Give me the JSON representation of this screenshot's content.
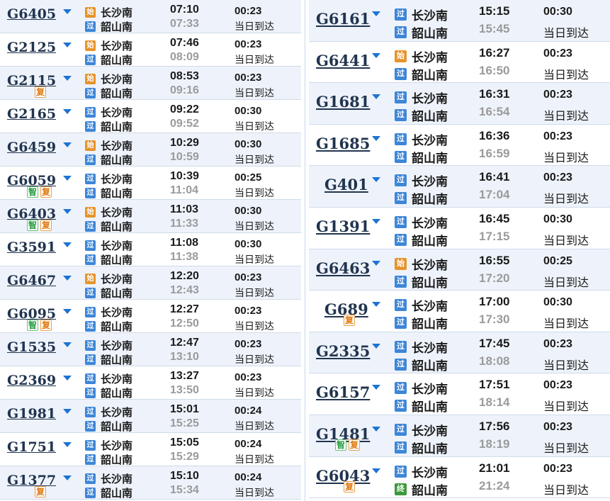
{
  "left_trains": [
    {
      "no": "G6405",
      "tags": [],
      "from_icon": "始",
      "from": "长沙南",
      "to_icon": "过",
      "to": "韶山南",
      "dep": "07:10",
      "arr": "07:33",
      "dur": "00:23",
      "arrive": "当日到达"
    },
    {
      "no": "G2125",
      "tags": [],
      "from_icon": "始",
      "from": "长沙南",
      "to_icon": "过",
      "to": "韶山南",
      "dep": "07:46",
      "arr": "08:09",
      "dur": "00:23",
      "arrive": "当日到达"
    },
    {
      "no": "G2115",
      "tags": [
        "复"
      ],
      "from_icon": "始",
      "from": "长沙南",
      "to_icon": "过",
      "to": "韶山南",
      "dep": "08:53",
      "arr": "09:16",
      "dur": "00:23",
      "arrive": "当日到达"
    },
    {
      "no": "G2165",
      "tags": [],
      "from_icon": "过",
      "from": "长沙南",
      "to_icon": "过",
      "to": "韶山南",
      "dep": "09:22",
      "arr": "09:52",
      "dur": "00:30",
      "arrive": "当日到达"
    },
    {
      "no": "G6459",
      "tags": [],
      "from_icon": "始",
      "from": "长沙南",
      "to_icon": "过",
      "to": "韶山南",
      "dep": "10:29",
      "arr": "10:59",
      "dur": "00:30",
      "arrive": "当日到达"
    },
    {
      "no": "G6059",
      "tags": [
        "智",
        "复"
      ],
      "from_icon": "过",
      "from": "长沙南",
      "to_icon": "过",
      "to": "韶山南",
      "dep": "10:39",
      "arr": "11:04",
      "dur": "00:25",
      "arrive": "当日到达"
    },
    {
      "no": "G6403",
      "tags": [
        "智",
        "复"
      ],
      "from_icon": "始",
      "from": "长沙南",
      "to_icon": "过",
      "to": "韶山南",
      "dep": "11:03",
      "arr": "11:33",
      "dur": "00:30",
      "arrive": "当日到达"
    },
    {
      "no": "G3591",
      "tags": [],
      "from_icon": "过",
      "from": "长沙南",
      "to_icon": "过",
      "to": "韶山南",
      "dep": "11:08",
      "arr": "11:38",
      "dur": "00:30",
      "arrive": "当日到达"
    },
    {
      "no": "G6467",
      "tags": [],
      "from_icon": "始",
      "from": "长沙南",
      "to_icon": "过",
      "to": "韶山南",
      "dep": "12:20",
      "arr": "12:43",
      "dur": "00:23",
      "arrive": "当日到达"
    },
    {
      "no": "G6095",
      "tags": [
        "智",
        "复"
      ],
      "from_icon": "过",
      "from": "长沙南",
      "to_icon": "过",
      "to": "韶山南",
      "dep": "12:27",
      "arr": "12:50",
      "dur": "00:23",
      "arrive": "当日到达"
    },
    {
      "no": "G1535",
      "tags": [],
      "from_icon": "过",
      "from": "长沙南",
      "to_icon": "过",
      "to": "韶山南",
      "dep": "12:47",
      "arr": "13:10",
      "dur": "00:23",
      "arrive": "当日到达"
    },
    {
      "no": "G2369",
      "tags": [],
      "from_icon": "过",
      "from": "长沙南",
      "to_icon": "过",
      "to": "韶山南",
      "dep": "13:27",
      "arr": "13:50",
      "dur": "00:23",
      "arrive": "当日到达"
    },
    {
      "no": "G1981",
      "tags": [],
      "from_icon": "过",
      "from": "长沙南",
      "to_icon": "过",
      "to": "韶山南",
      "dep": "15:01",
      "arr": "15:25",
      "dur": "00:24",
      "arrive": "当日到达"
    },
    {
      "no": "G1751",
      "tags": [],
      "from_icon": "过",
      "from": "长沙南",
      "to_icon": "过",
      "to": "韶山南",
      "dep": "15:05",
      "arr": "15:29",
      "dur": "00:24",
      "arrive": "当日到达"
    },
    {
      "no": "G1377",
      "tags": [
        "复"
      ],
      "from_icon": "过",
      "from": "长沙南",
      "to_icon": "过",
      "to": "韶山南",
      "dep": "15:10",
      "arr": "15:34",
      "dur": "00:24",
      "arrive": "当日到达"
    }
  ],
  "right_trains": [
    {
      "no": "G6161",
      "tags": [],
      "from_icon": "过",
      "from": "长沙南",
      "to_icon": "过",
      "to": "韶山南",
      "dep": "15:15",
      "arr": "15:45",
      "dur": "00:30",
      "arrive": "当日到达"
    },
    {
      "no": "G6441",
      "tags": [],
      "from_icon": "始",
      "from": "长沙南",
      "to_icon": "过",
      "to": "韶山南",
      "dep": "16:27",
      "arr": "16:50",
      "dur": "00:23",
      "arrive": "当日到达"
    },
    {
      "no": "G1681",
      "tags": [],
      "from_icon": "过",
      "from": "长沙南",
      "to_icon": "过",
      "to": "韶山南",
      "dep": "16:31",
      "arr": "16:54",
      "dur": "00:23",
      "arrive": "当日到达"
    },
    {
      "no": "G1685",
      "tags": [],
      "from_icon": "过",
      "from": "长沙南",
      "to_icon": "过",
      "to": "韶山南",
      "dep": "16:36",
      "arr": "16:59",
      "dur": "00:23",
      "arrive": "当日到达"
    },
    {
      "no": "G401",
      "tags": [],
      "from_icon": "过",
      "from": "长沙南",
      "to_icon": "过",
      "to": "韶山南",
      "dep": "16:41",
      "arr": "17:04",
      "dur": "00:23",
      "arrive": "当日到达"
    },
    {
      "no": "G1391",
      "tags": [],
      "from_icon": "过",
      "from": "长沙南",
      "to_icon": "过",
      "to": "韶山南",
      "dep": "16:45",
      "arr": "17:15",
      "dur": "00:30",
      "arrive": "当日到达"
    },
    {
      "no": "G6463",
      "tags": [],
      "from_icon": "始",
      "from": "长沙南",
      "to_icon": "过",
      "to": "韶山南",
      "dep": "16:55",
      "arr": "17:20",
      "dur": "00:25",
      "arrive": "当日到达"
    },
    {
      "no": "G689",
      "tags": [
        "复"
      ],
      "from_icon": "过",
      "from": "长沙南",
      "to_icon": "过",
      "to": "韶山南",
      "dep": "17:00",
      "arr": "17:30",
      "dur": "00:30",
      "arrive": "当日到达"
    },
    {
      "no": "G2335",
      "tags": [],
      "from_icon": "过",
      "from": "长沙南",
      "to_icon": "过",
      "to": "韶山南",
      "dep": "17:45",
      "arr": "18:08",
      "dur": "00:23",
      "arrive": "当日到达"
    },
    {
      "no": "G6157",
      "tags": [],
      "from_icon": "过",
      "from": "长沙南",
      "to_icon": "过",
      "to": "韶山南",
      "dep": "17:51",
      "arr": "18:14",
      "dur": "00:23",
      "arrive": "当日到达"
    },
    {
      "no": "G1481",
      "tags": [
        "智",
        "复"
      ],
      "from_icon": "过",
      "from": "长沙南",
      "to_icon": "过",
      "to": "韶山南",
      "dep": "17:56",
      "arr": "18:19",
      "dur": "00:23",
      "arrive": "当日到达"
    },
    {
      "no": "G6043",
      "tags": [
        "复"
      ],
      "from_icon": "过",
      "from": "长沙南",
      "to_icon": "终",
      "to": "韶山南",
      "dep": "21:01",
      "arr": "21:24",
      "dur": "00:23",
      "arrive": "当日到达"
    }
  ],
  "colors": {
    "accent": "#1e73d2",
    "origin_icon": "#e7932c",
    "pass_icon": "#3d86d8",
    "terminal_icon": "#3c9a3c",
    "row_alt": "#eef3fb"
  }
}
